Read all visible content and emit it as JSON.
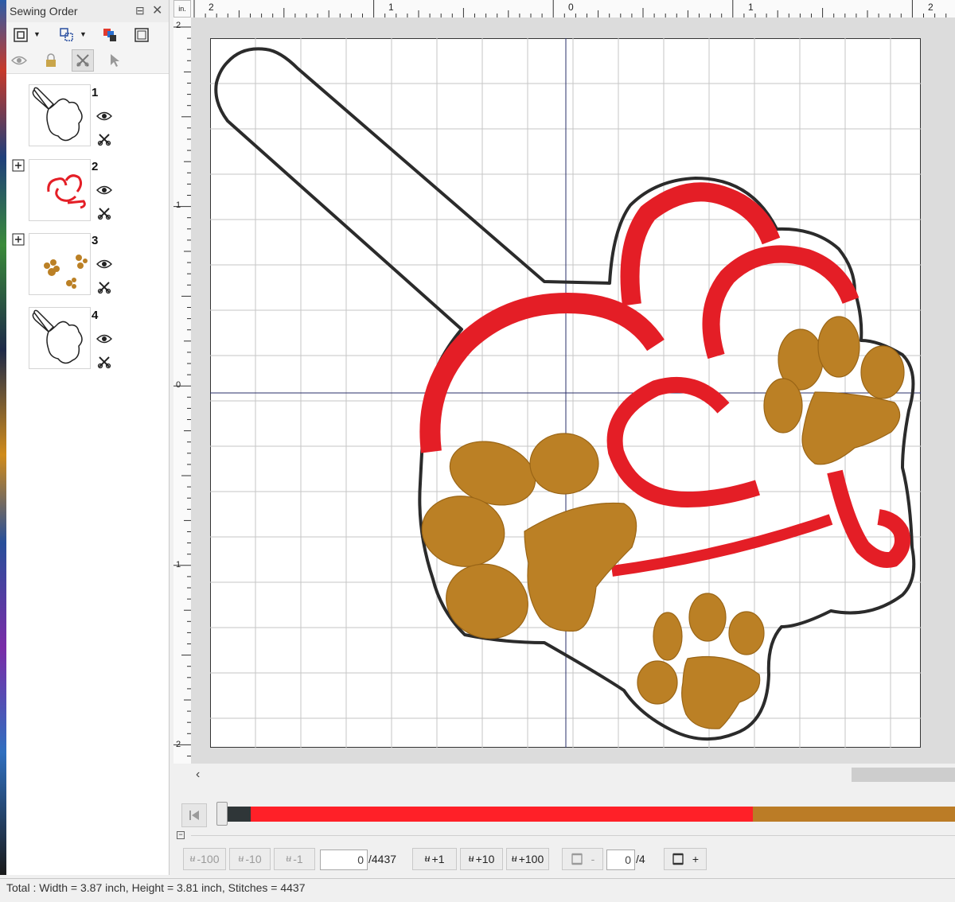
{
  "panel": {
    "title": "Sewing Order",
    "toolbar_icons": [
      "select-all-icon",
      "group-icon",
      "color-sort-icon",
      "frame-icon"
    ],
    "toolbar2_icons": [
      "eye-icon",
      "lock-icon",
      "tools-icon",
      "pointer-icon"
    ],
    "items": [
      {
        "number": "1",
        "thumbnail": "outline-shape",
        "expandable": false
      },
      {
        "number": "2",
        "thumbnail": "red-hearts",
        "expandable": true
      },
      {
        "number": "3",
        "thumbnail": "brown-paws",
        "expandable": true
      },
      {
        "number": "4",
        "thumbnail": "outline-shape",
        "expandable": false
      }
    ]
  },
  "ruler": {
    "unit": "in.",
    "top_labels": [
      "2",
      "1",
      "0",
      "1",
      "2"
    ],
    "left_labels": [
      "2",
      "1",
      "0",
      "1",
      "2"
    ]
  },
  "colors": {
    "outline": "#2b2b2b",
    "heart_red": "#e41e26",
    "paw_brown": "#bb8025",
    "grid": "#c6c6c6",
    "axis": "#2a2f6a"
  },
  "simulator": {
    "segments": [
      {
        "color": "#2f3638",
        "fraction": 0.046
      },
      {
        "color": "#ff2028",
        "fraction": 0.68
      },
      {
        "color": "#bb7c26",
        "fraction": 0.274
      }
    ]
  },
  "controls": {
    "minus100": "-100",
    "minus10": "-10",
    "minus1": "-1",
    "stitch_value": "0",
    "stitch_total": "/4437",
    "plus1": "+1",
    "plus10": "+10",
    "plus100": "+100",
    "frame_minus": "-",
    "frame_value": "0",
    "frame_total": "/4",
    "frame_plus": "+"
  },
  "status": {
    "text": "Total : Width = 3.87 inch, Height = 3.81 inch, Stitches = 4437"
  }
}
